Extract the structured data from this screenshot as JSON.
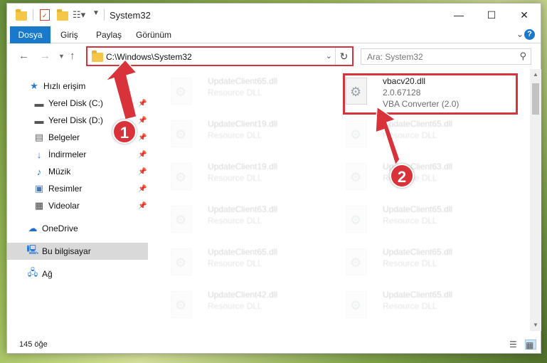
{
  "window": {
    "title": "System32"
  },
  "ribbon": {
    "file_tab": "Dosya",
    "tabs": [
      "Giriş",
      "Paylaş",
      "Görünüm"
    ]
  },
  "nav": {
    "address": "C:\\Windows\\System32",
    "search_placeholder": "Ara: System32"
  },
  "sidebar": {
    "items": [
      {
        "label": "Hızlı erişim",
        "icon": "star-icon"
      },
      {
        "label": "Yerel Disk (C:)",
        "icon": "drive-icon",
        "pinned": true
      },
      {
        "label": "Yerel Disk (D:)",
        "icon": "drive-icon",
        "pinned": true
      },
      {
        "label": "Belgeler",
        "icon": "documents-icon",
        "pinned": true
      },
      {
        "label": "İndirmeler",
        "icon": "download-icon",
        "pinned": true
      },
      {
        "label": "Müzik",
        "icon": "music-icon",
        "pinned": true
      },
      {
        "label": "Resimler",
        "icon": "pictures-icon",
        "pinned": true
      },
      {
        "label": "Videolar",
        "icon": "video-icon",
        "pinned": true
      },
      {
        "label": "OneDrive",
        "icon": "cloud-icon"
      },
      {
        "label": "Bu bilgisayar",
        "icon": "computer-icon",
        "selected": true
      },
      {
        "label": "Ağ",
        "icon": "network-icon"
      }
    ]
  },
  "files": {
    "highlighted": {
      "name": "vbacv20.dll",
      "version": "2.0.67128",
      "description": "VBA Converter (2.0)"
    },
    "left_column": [
      {
        "name": "UpdateClient65.dll",
        "type": "Resource DLL"
      },
      {
        "name": "UpdateClient19.dll",
        "type": "Resource DLL"
      },
      {
        "name": "UpdateClient19.dll",
        "type": "Resource DLL"
      },
      {
        "name": "UpdateClient63.dll",
        "type": "Resource DLL"
      },
      {
        "name": "UpdateClient65.dll",
        "type": "Resource DLL"
      },
      {
        "name": "UpdateClient42.dll",
        "type": "Resource DLL"
      }
    ],
    "right_column": [
      {
        "name": "UpdateClient65.dll",
        "type": "Resource DLL"
      },
      {
        "name": "UpdateClient63.dll",
        "type": "Resource DLL"
      },
      {
        "name": "UpdateClient65.dll",
        "type": "Resource DLL"
      },
      {
        "name": "UpdateClient65.dll",
        "type": "Resource DLL"
      },
      {
        "name": "UpdateClient65.dll",
        "type": "Resource DLL"
      }
    ]
  },
  "status": {
    "item_count": "145 öğe"
  },
  "callouts": [
    "1",
    "2"
  ],
  "colors": {
    "accent": "#1979ca",
    "highlight": "#d8333a"
  }
}
